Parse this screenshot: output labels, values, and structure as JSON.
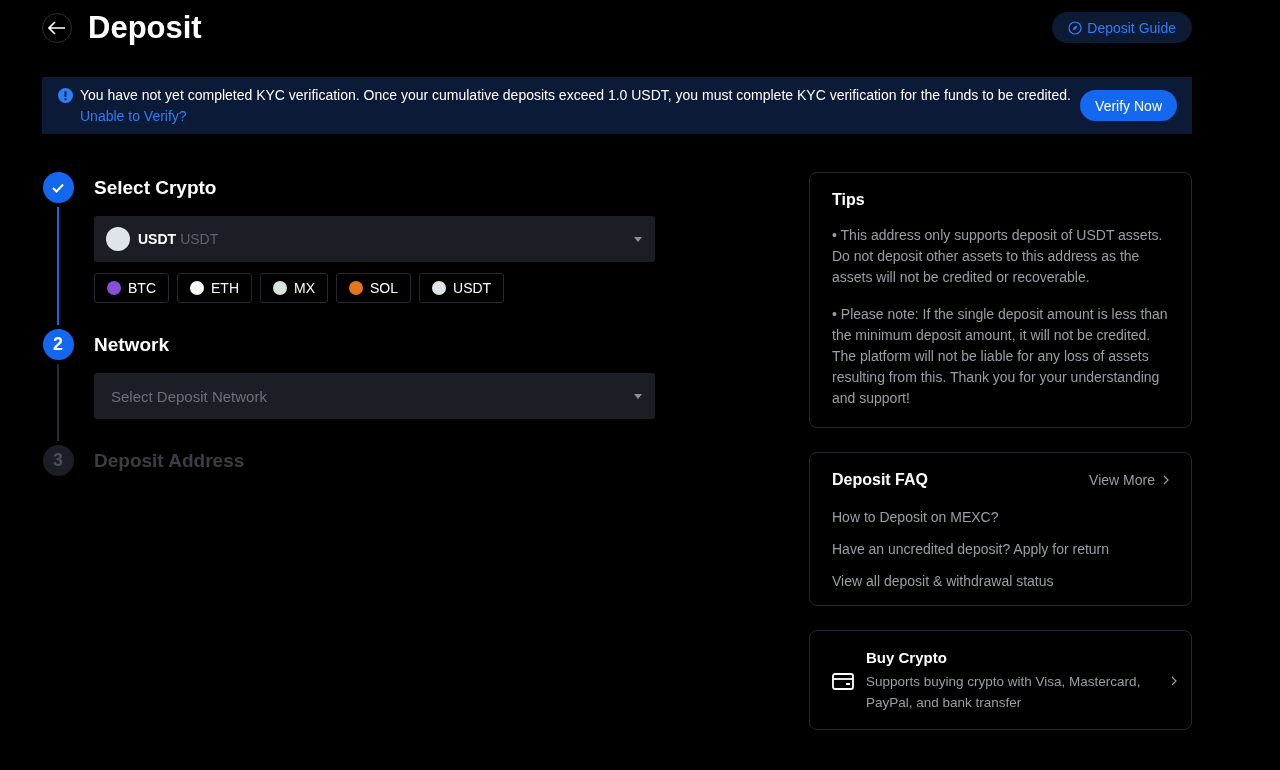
{
  "header": {
    "title": "Deposit",
    "guide_button": "Deposit Guide"
  },
  "kyc_banner": {
    "message": "You have not yet completed KYC verification. Once your cumulative deposits exceed 1.0 USDT, you must complete KYC verification for the funds to be credited.",
    "link": "Unable to Verify?",
    "button": "Verify Now"
  },
  "steps": [
    {
      "title": "Select Crypto",
      "completed": true,
      "disabled": false,
      "kind": "crypto",
      "select": {
        "value": "USDT",
        "sub": "USDT"
      },
      "coins": [
        {
          "label": "BTC",
          "color": "#8a4fd8"
        },
        {
          "label": "ETH",
          "color": "#ffffff"
        },
        {
          "label": "MX",
          "color": "#d8e4dc"
        },
        {
          "label": "SOL",
          "color": "#e2761b"
        },
        {
          "label": "USDT",
          "color": "#dfe4ea"
        }
      ]
    },
    {
      "number": "2",
      "title": "Network",
      "completed": false,
      "disabled": false,
      "kind": "network",
      "select": {
        "placeholder": "Select Deposit Network"
      }
    },
    {
      "number": "3",
      "title": "Deposit Address",
      "completed": false,
      "disabled": true,
      "kind": "address"
    }
  ],
  "tips": {
    "title": "Tips",
    "paragraphs": [
      "• This address only supports deposit of USDT assets. Do not deposit other assets to this address as the assets will not be credited or recoverable.",
      "• Please note: If the single deposit amount is less than the minimum deposit amount, it will not be credited. The platform will not be liable for any loss of assets resulting from this. Thank you for your understanding and support!"
    ]
  },
  "faq": {
    "title": "Deposit FAQ",
    "view_more": "View More",
    "items": [
      "How to Deposit on MEXC?",
      "Have an uncredited deposit? Apply for return",
      "View all deposit & withdrawal status"
    ]
  },
  "buy_crypto": {
    "title": "Buy Crypto",
    "description": "Supports buying crypto with Visa, Mastercard, PayPal, and bank transfer"
  }
}
